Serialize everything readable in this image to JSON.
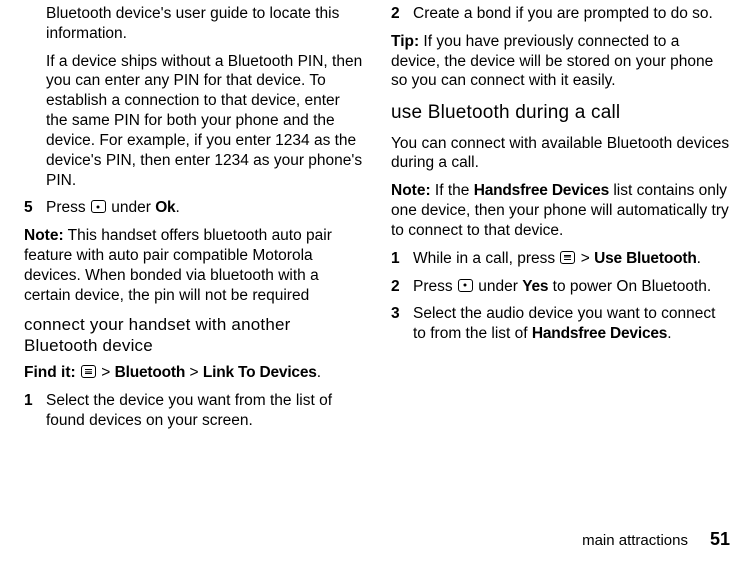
{
  "left": {
    "p1": "Bluetooth device's user guide to locate this information.",
    "p2": "If a device ships without a Bluetooth PIN, then you can enter any PIN for that device. To establish a connection to that device, enter the same PIN for both your phone and the device. For example, if you enter 1234 as the device's PIN, then enter 1234 as your phone's PIN.",
    "step5_num": "5",
    "step5_a": "Press ",
    "step5_b": " under ",
    "step5_ok": "Ok",
    "step5_c": ".",
    "note_label": "Note:",
    "note_text": " This handset offers bluetooth auto pair feature with auto pair compatible Motorola devices. When bonded via bluetooth with a certain device, the pin will not be required",
    "h1": "connect your handset with another Bluetooth device",
    "findit_label": "Find it: ",
    "findit_gt1": " > ",
    "findit_bt": "Bluetooth",
    "findit_gt2": " > ",
    "findit_link": "Link To Devices",
    "findit_dot": ".",
    "step1_num": "1",
    "step1_text": "Select the device you want from the list of found devices on your screen."
  },
  "right": {
    "step2_num": "2",
    "step2_text": "Create a bond if you are prompted to do so.",
    "tip_label": "Tip:",
    "tip_text": " If you have previously connected to a device, the device will be stored on your phone so you can connect with it easily.",
    "h2": "use Bluetooth during a call",
    "p1": "You can connect with available Bluetooth devices during a call.",
    "note_label": "Note:",
    "note_a": " If the ",
    "note_hd": "Handsfree Devices",
    "note_b": " list contains only one device, then your phone will automatically try to connect to that device.",
    "s1_num": "1",
    "s1_a": "While in a call, press ",
    "s1_gt": " > ",
    "s1_ub": "Use Bluetooth",
    "s1_dot": ".",
    "s2_num": "2",
    "s2_a": "Press ",
    "s2_b": " under ",
    "s2_yes": "Yes",
    "s2_c": " to power On Bluetooth.",
    "s3_num": "3",
    "s3_a": "Select the audio device you want to connect to from the list of ",
    "s3_hd": "Handsfree Devices",
    "s3_dot": "."
  },
  "footer": {
    "section": "main attractions",
    "page": "51"
  }
}
